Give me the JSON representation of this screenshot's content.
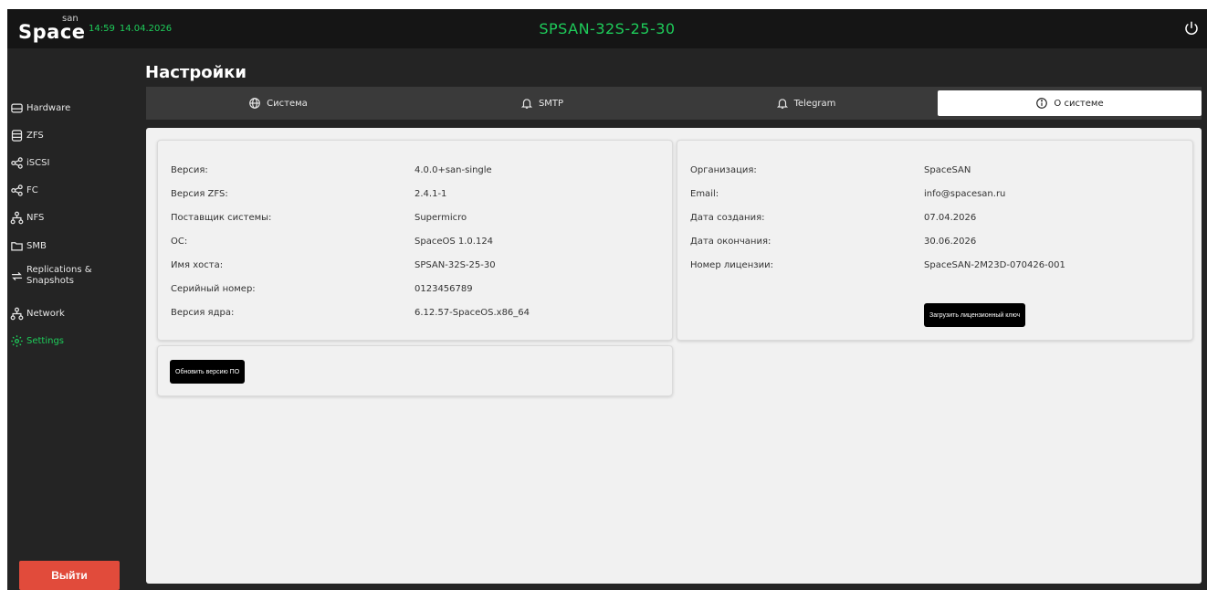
{
  "header": {
    "logo_text": "Space",
    "logo_sup": "san",
    "time": "14:59",
    "date": "14.04.2026",
    "hostname": "SPSAN-32S-25-30",
    "accent_color": "#1ecc5a"
  },
  "sidebar": {
    "items": [
      {
        "label": "Hardware",
        "icon": "hdd-icon"
      },
      {
        "label": "ZFS",
        "icon": "database-icon"
      },
      {
        "label": "iSCSI",
        "icon": "share-icon"
      },
      {
        "label": "FC",
        "icon": "share-icon"
      },
      {
        "label": "NFS",
        "icon": "network-tree-icon"
      },
      {
        "label": "SMB",
        "icon": "folder-icon"
      },
      {
        "label_line1": "Replications &",
        "label_line2": "Snapshots",
        "icon": "sync-arrows-icon"
      },
      {
        "label": "Network",
        "icon": "network-tree-icon"
      },
      {
        "label": "Settings",
        "icon": "gear-icon",
        "active": true
      }
    ],
    "logout_label": "Выйти",
    "logout_color": "#e14b3b"
  },
  "page": {
    "title": "Настройки",
    "tabs": [
      {
        "label": "Система",
        "icon": "globe-icon"
      },
      {
        "label": "SMTP",
        "icon": "bell-icon"
      },
      {
        "label": "Telegram",
        "icon": "bell-icon"
      },
      {
        "label": "О системе",
        "icon": "info-icon",
        "active": true
      }
    ]
  },
  "system_info": {
    "rows": [
      {
        "key": "Версия:",
        "value": "4.0.0+san-single"
      },
      {
        "key": "Версия ZFS:",
        "value": "2.4.1-1"
      },
      {
        "key": "Поставщик системы:",
        "value": "Supermicro"
      },
      {
        "key": "ОС:",
        "value": "SpaceOS 1.0.124"
      },
      {
        "key": "Имя хоста:",
        "value": "SPSAN-32S-25-30"
      },
      {
        "key": "Серийный номер:",
        "value": "0123456789"
      },
      {
        "key": "Версия ядра:",
        "value": "6.12.57-SpaceOS.x86_64"
      }
    ],
    "update_button": "Обновить версию ПО"
  },
  "license_info": {
    "rows": [
      {
        "key": "Организация:",
        "value": "SpaceSAN"
      },
      {
        "key": "Email:",
        "value": "info@spacesan.ru"
      },
      {
        "key": "Дата создания:",
        "value": "07.04.2026"
      },
      {
        "key": "Дата окончания:",
        "value": "30.06.2026"
      },
      {
        "key": "Номер лицензии:",
        "value": "SpaceSAN-2M23D-070426-001"
      }
    ],
    "upload_button": "Загрузить лицензионный ключ"
  }
}
